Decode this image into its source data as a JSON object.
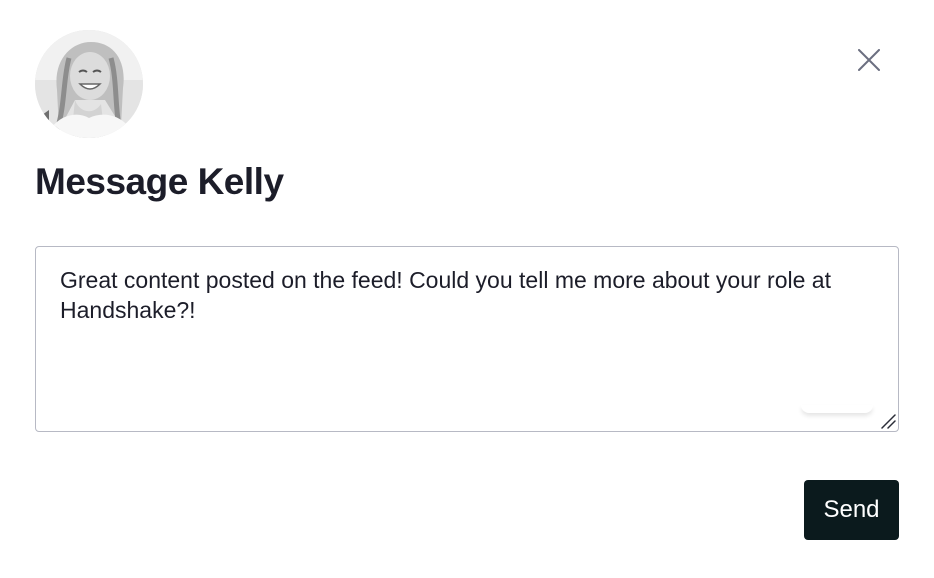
{
  "dialog": {
    "title": "Message Kelly",
    "close_icon": "close-icon",
    "avatar_icon": "avatar"
  },
  "message": {
    "value": "Great content posted on the feed! Could you tell me more about your role at Handshake?!"
  },
  "actions": {
    "send_label": "Send"
  },
  "colors": {
    "title_text": "#1c1d29",
    "send_button_bg": "#0b1a1d",
    "input_border": "#b7b9c4"
  }
}
